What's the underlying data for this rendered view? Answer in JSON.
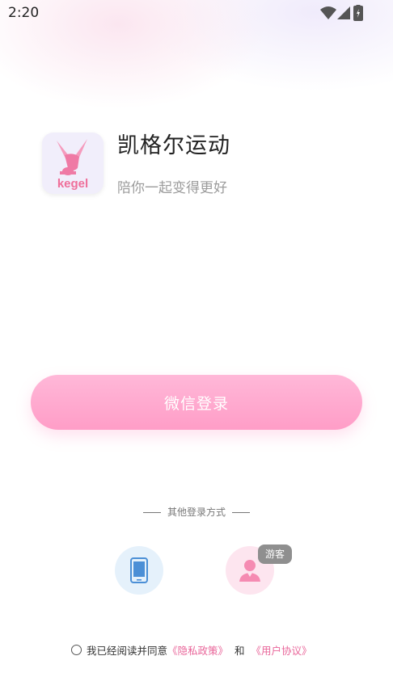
{
  "status_bar": {
    "time": "2:20"
  },
  "header": {
    "logo_text": "kegel",
    "title": "凯格尔运动",
    "subtitle": "陪你一起变得更好"
  },
  "login": {
    "wechat_button_label": "微信登录",
    "other_methods_label": "其他登录方式",
    "guest_badge": "游客"
  },
  "agreement": {
    "prefix": "我已经阅读并同意",
    "privacy_link": "《隐私政策》",
    "conjunction": "和",
    "terms_link": "《用户协议》"
  },
  "colors": {
    "accent_pink": "#ff9dc7",
    "link_pink": "#e9669a",
    "phone_icon_blue": "#4b8fd6"
  }
}
